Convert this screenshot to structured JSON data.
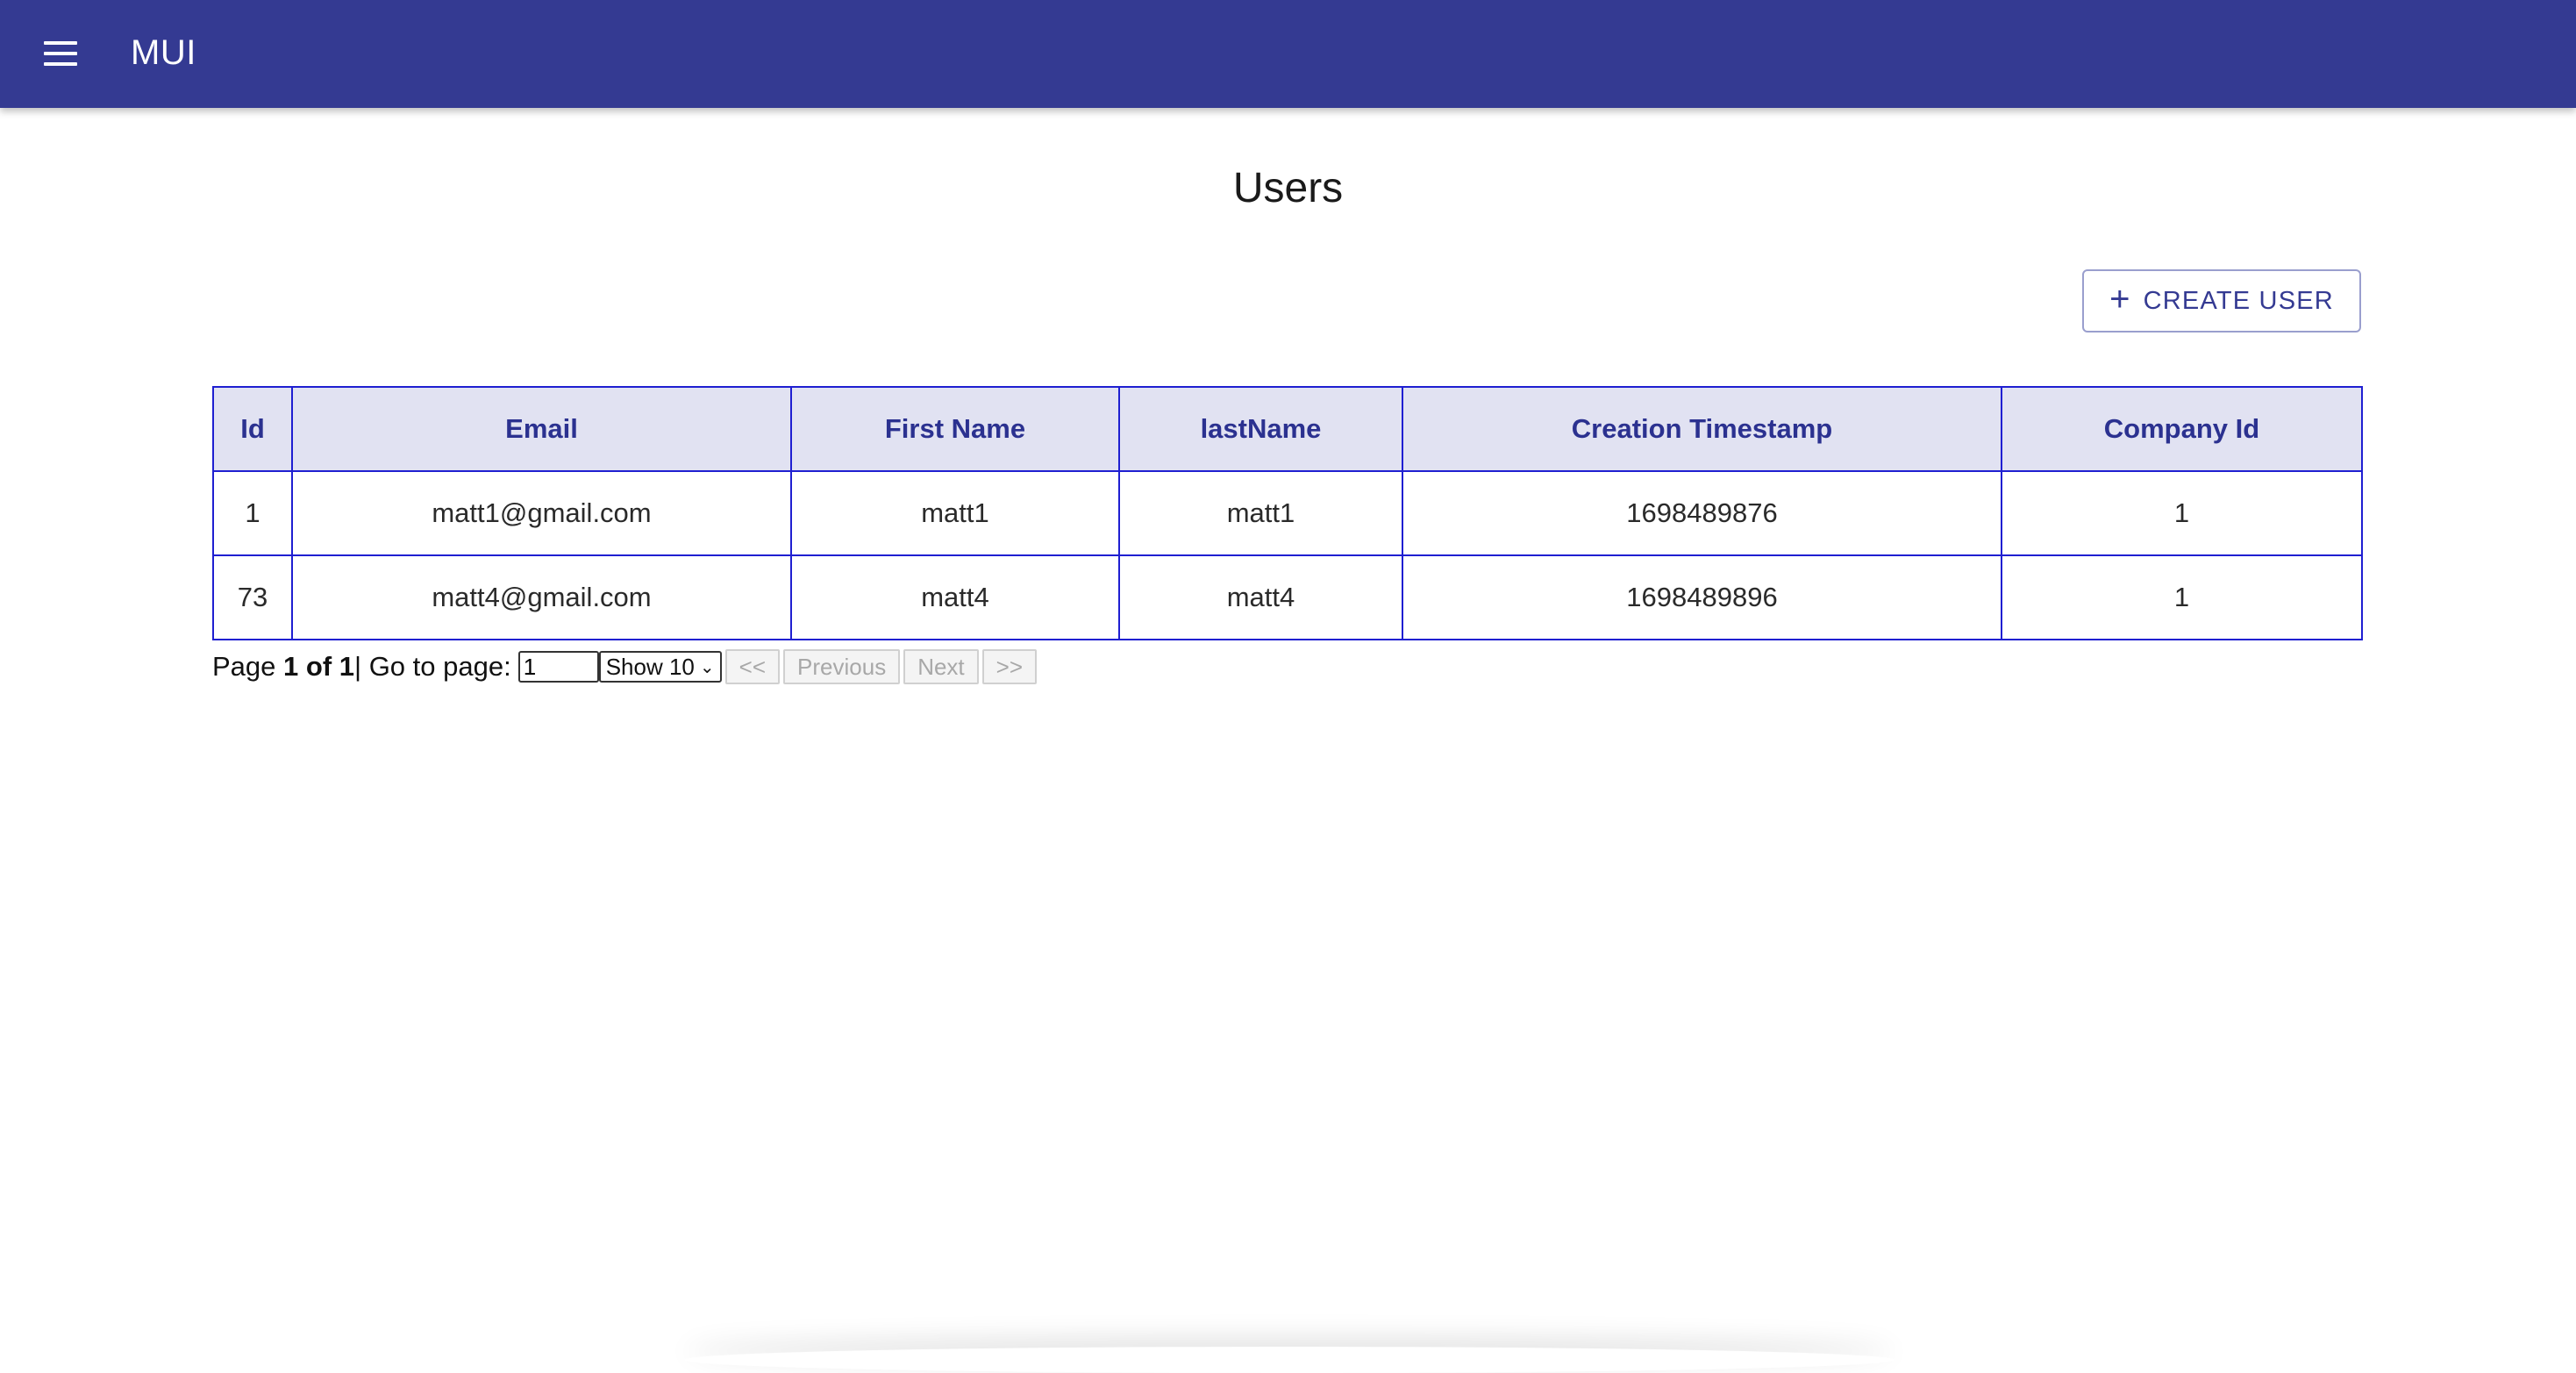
{
  "appbar": {
    "brand": "MUI",
    "menu_icon": "hamburger-menu-icon",
    "color": "#343a92"
  },
  "page": {
    "title": "Users"
  },
  "toolbar": {
    "create_label": "CREATE USER",
    "create_icon": "plus-icon"
  },
  "table": {
    "columns": [
      "Id",
      "Email",
      "First Name",
      "lastName",
      "Creation Timestamp",
      "Company Id"
    ],
    "rows": [
      [
        "1",
        "matt1@gmail.com",
        "matt1",
        "matt1",
        "1698489876",
        "1"
      ],
      [
        "73",
        "matt4@gmail.com",
        "matt4",
        "matt4",
        "1698489896",
        "1"
      ]
    ],
    "header_bg": "#e1e2f2",
    "border_color": "#1f1fd1"
  },
  "pager": {
    "page_label": "Page",
    "page_of": "1 of 1",
    "separator": "|",
    "goto_label": "Go to page:",
    "goto_value": "1",
    "show_label": "Show 10",
    "first_label": "<<",
    "prev_label": "Previous",
    "next_label": "Next",
    "last_label": ">>"
  }
}
